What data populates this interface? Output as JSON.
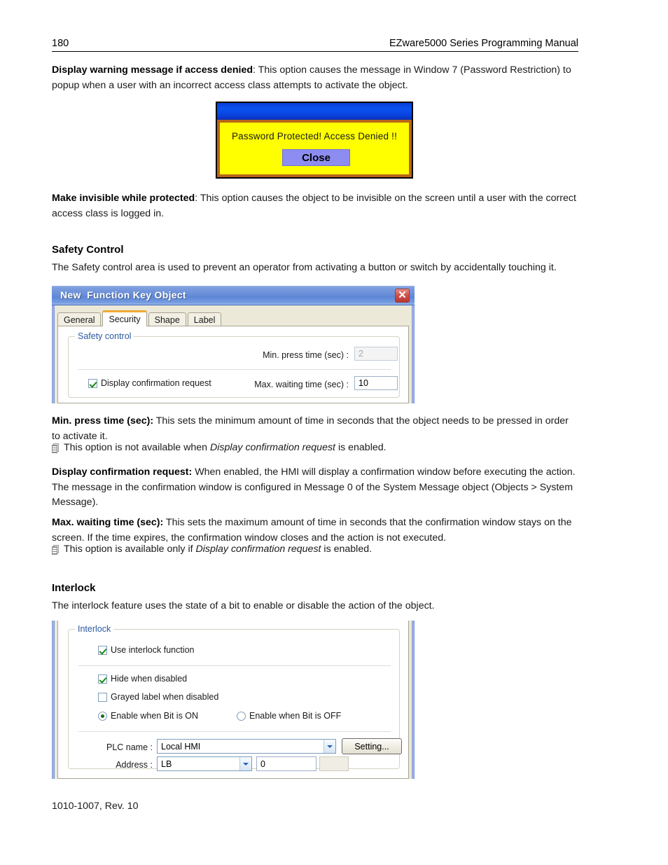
{
  "header": {
    "page_number": "180",
    "manual_title": "EZware5000 Series Programming Manual"
  },
  "footer": {
    "doc_id": "1010-1007, Rev. 10"
  },
  "paragraphs": {
    "warning_term": "Display warning message if access denied",
    "warning_body": ": This option causes the message in Window 7 (Password Restriction) to popup when a user with an incorrect access class attempts to activate the object.",
    "invisible_term": "Make invisible while protected",
    "invisible_body": ": This option causes the object to be invisible on the screen until a user with the correct access class is logged in.",
    "safety_heading": "Safety Control",
    "safety_intro": "The Safety control area is used to prevent an operator from activating a button or switch by accidentally touching it.",
    "min_press_term": "Min. press time (sec):",
    "min_press_body": " This sets the minimum amount of time in seconds that the object needs to be pressed in order to activate it.",
    "min_press_note_pre": "This option is not available when ",
    "min_press_note_em": "Display confirmation request",
    "min_press_note_post": " is enabled.",
    "display_conf_term": "Display confirmation request:",
    "display_conf_body": " When enabled, the HMI will display a confirmation window before executing the action. The message in the confirmation window is configured in Message 0 of the System Message object (Objects > System Message).",
    "max_wait_term": "Max. waiting time (sec):",
    "max_wait_body": " This sets the maximum amount of time in seconds that the confirmation window stays on the screen. If the time expires, the confirmation window closes and the action is not executed.",
    "max_wait_note_pre": "This option is available only if ",
    "max_wait_note_em": "Display confirmation request",
    "max_wait_note_post": " is enabled.",
    "interlock_heading": "Interlock",
    "interlock_intro": "The interlock feature uses the state of a bit to enable or disable the action of the object."
  },
  "hmi_popup": {
    "message": "Password Protected! Access Denied !!",
    "close_label": "Close",
    "title_color": "#0b52ef",
    "body_color": "#ffff00",
    "border_color": "#b8651b",
    "button_color": "#8d8cf0"
  },
  "function_key_dialog": {
    "title": "New  Function Key Object",
    "close_glyph": "✕",
    "tabs": [
      {
        "label": "General",
        "active": false
      },
      {
        "label": "Security",
        "active": true
      },
      {
        "label": "Shape",
        "active": false
      },
      {
        "label": "Label",
        "active": false
      }
    ],
    "active_tab_accent": "#f0a933",
    "safety_group": {
      "title": "Safety control",
      "min_press_label": "Min. press time (sec) :",
      "min_press_value": "2",
      "min_press_enabled": false,
      "display_confirmation_label": "Display confirmation request",
      "display_confirmation_checked": true,
      "max_waiting_label": "Max. waiting time (sec) :",
      "max_waiting_value": "10",
      "max_waiting_enabled": true
    }
  },
  "interlock_dialog": {
    "group_title": "Interlock",
    "use_interlock_label": "Use interlock function",
    "use_interlock_checked": true,
    "hide_when_disabled_label": "Hide when disabled",
    "hide_when_disabled_checked": true,
    "grayed_label_label": "Grayed label when disabled",
    "grayed_label_checked": false,
    "bit_on_label": "Enable when Bit is ON",
    "bit_on_selected": true,
    "bit_off_label": "Enable when Bit is OFF",
    "bit_off_selected": false,
    "plc_name_label": "PLC name :",
    "plc_name_value": "Local HMI",
    "setting_button_label": "Setting...",
    "address_label": "Address :",
    "address_type_value": "LB",
    "address_value": "0",
    "address_extra_value": ""
  }
}
